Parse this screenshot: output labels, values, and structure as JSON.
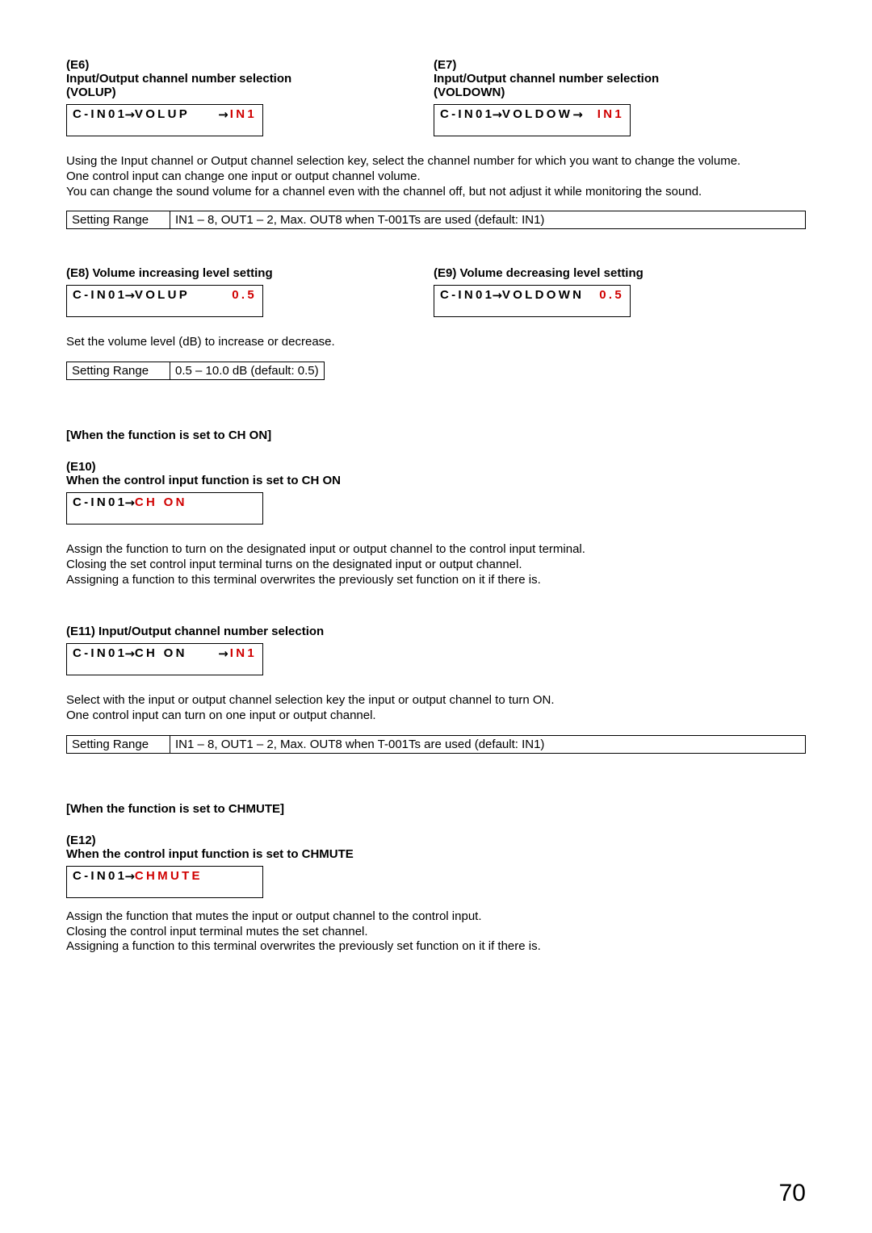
{
  "page_number": "70",
  "e6": {
    "tag": "(E6)",
    "title1": "Input/Output channel number selection",
    "title2": "(VOLUP)",
    "lcd_left": "C-IN01",
    "lcd_mid": "VOLUP",
    "lcd_val": "IN1"
  },
  "e7": {
    "tag": "(E7)",
    "title1": "Input/Output channel number selection",
    "title2": "(VOLDOWN)",
    "lcd_left": "C-IN01",
    "lcd_mid": "VOLDOW",
    "lcd_val": "IN1"
  },
  "e6e7_p1": "Using the Input channel or Output channel selection key, select the channel number for which you want to change the volume.",
  "e6e7_p2": "One control input can change one input or output channel volume.",
  "e6e7_p3": "You can change the sound volume for a channel even with the channel off, but not adjust it while monitoring the sound.",
  "range1": {
    "label": "Setting Range",
    "value": "IN1 – 8, OUT1 – 2, Max. OUT8 when T-001Ts are used (default: IN1)"
  },
  "e8": {
    "title": "(E8) Volume increasing level setting",
    "lcd_left": "C-IN01",
    "lcd_mid": "VOLUP",
    "lcd_val": "0.5"
  },
  "e9": {
    "title": "(E9) Volume decreasing level setting",
    "lcd_left": "C-IN01",
    "lcd_mid": "VOLDOWN",
    "lcd_val": "0.5"
  },
  "e8e9_p1": "Set the volume level (dB) to increase or decrease.",
  "range2": {
    "label": "Setting Range",
    "value": "0.5 – 10.0 dB (default: 0.5)"
  },
  "chon_hdr": "[When the function is set to CH ON]",
  "e10": {
    "tag": "(E10)",
    "title": "When the control input function is set to CH ON",
    "lcd_left": "C-IN01",
    "lcd_mid": "CH ON"
  },
  "e10_p1": "Assign the function to turn on the designated input or output channel to the control input terminal.",
  "e10_p2": "Closing the set control input terminal turns on the designated input or output channel.",
  "e10_p3": "Assigning a function to this terminal overwrites the previously set function on it if there is.",
  "e11": {
    "title": "(E11) Input/Output channel number selection",
    "lcd_left": "C-IN01",
    "lcd_mid": "CH ON",
    "lcd_val": "IN1"
  },
  "e11_p1": "Select with the input or output channel selection key the input or output channel to turn ON.",
  "e11_p2": "One control input can turn on one input or output channel.",
  "range3": {
    "label": "Setting Range",
    "value": "IN1 – 8, OUT1 – 2, Max. OUT8 when T-001Ts are used (default: IN1)"
  },
  "chmute_hdr": "[When the function is set to CHMUTE]",
  "e12": {
    "tag": "(E12)",
    "title": "When the control input function is set to CHMUTE",
    "lcd_left": "C-IN01",
    "lcd_mid": "CHMUTE"
  },
  "e12_p1": "Assign the function that mutes the input or output channel to the control input.",
  "e12_p2": "Closing the control input terminal mutes the set channel.",
  "e12_p3": "Assigning a function to this terminal overwrites the previously set function on it if there is."
}
